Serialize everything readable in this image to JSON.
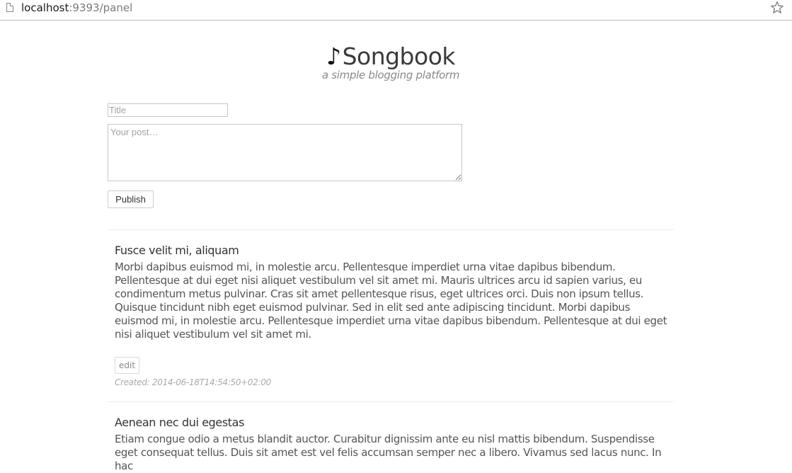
{
  "browser": {
    "url_host": "localhost",
    "url_rest": ":9393/panel",
    "page_icon": "page-icon",
    "bookmark_icon": "star-icon"
  },
  "header": {
    "logo_glyph": "♪",
    "title": "Songbook",
    "tagline": "a simple blogging platform"
  },
  "form": {
    "title_placeholder": "Title",
    "title_value": "",
    "post_placeholder": "Your post…",
    "post_value": "",
    "publish_label": "Publish"
  },
  "posts": [
    {
      "title": "Fusce velit mi, aliquam",
      "body": "Morbi dapibus euismod mi, in molestie arcu. Pellentesque imperdiet urna vitae dapibus bibendum. Pellentesque at dui eget nisi aliquet vestibulum vel sit amet mi. Mauris ultrices arcu id sapien varius, eu condimentum metus pulvinar. Cras sit amet pellentesque risus, eget ultrices orci. Duis non ipsum tellus. Quisque tincidunt nibh eget euismod pulvinar. Sed in elit sed ante adipiscing tincidunt. Morbi dapibus euismod mi, in molestie arcu. Pellentesque imperdiet urna vitae dapibus bibendum. Pellentesque at dui eget nisi aliquet vestibulum vel sit amet mi.",
      "edit_label": "edit",
      "created": "Created: 2014-06-18T14:54:50+02:00"
    },
    {
      "title": "Aenean nec dui egestas",
      "body": "Etiam congue odio a metus blandit auctor. Curabitur dignissim ante eu nisl mattis bibendum. Suspendisse eget consequat tellus. Duis sit amet est vel felis accumsan semper nec a libero. Vivamus sed lacus nunc. In hac"
    }
  ],
  "colors": {
    "text": "#444444",
    "muted": "#888888",
    "divider": "#ececec",
    "border": "#c6c6c6"
  }
}
